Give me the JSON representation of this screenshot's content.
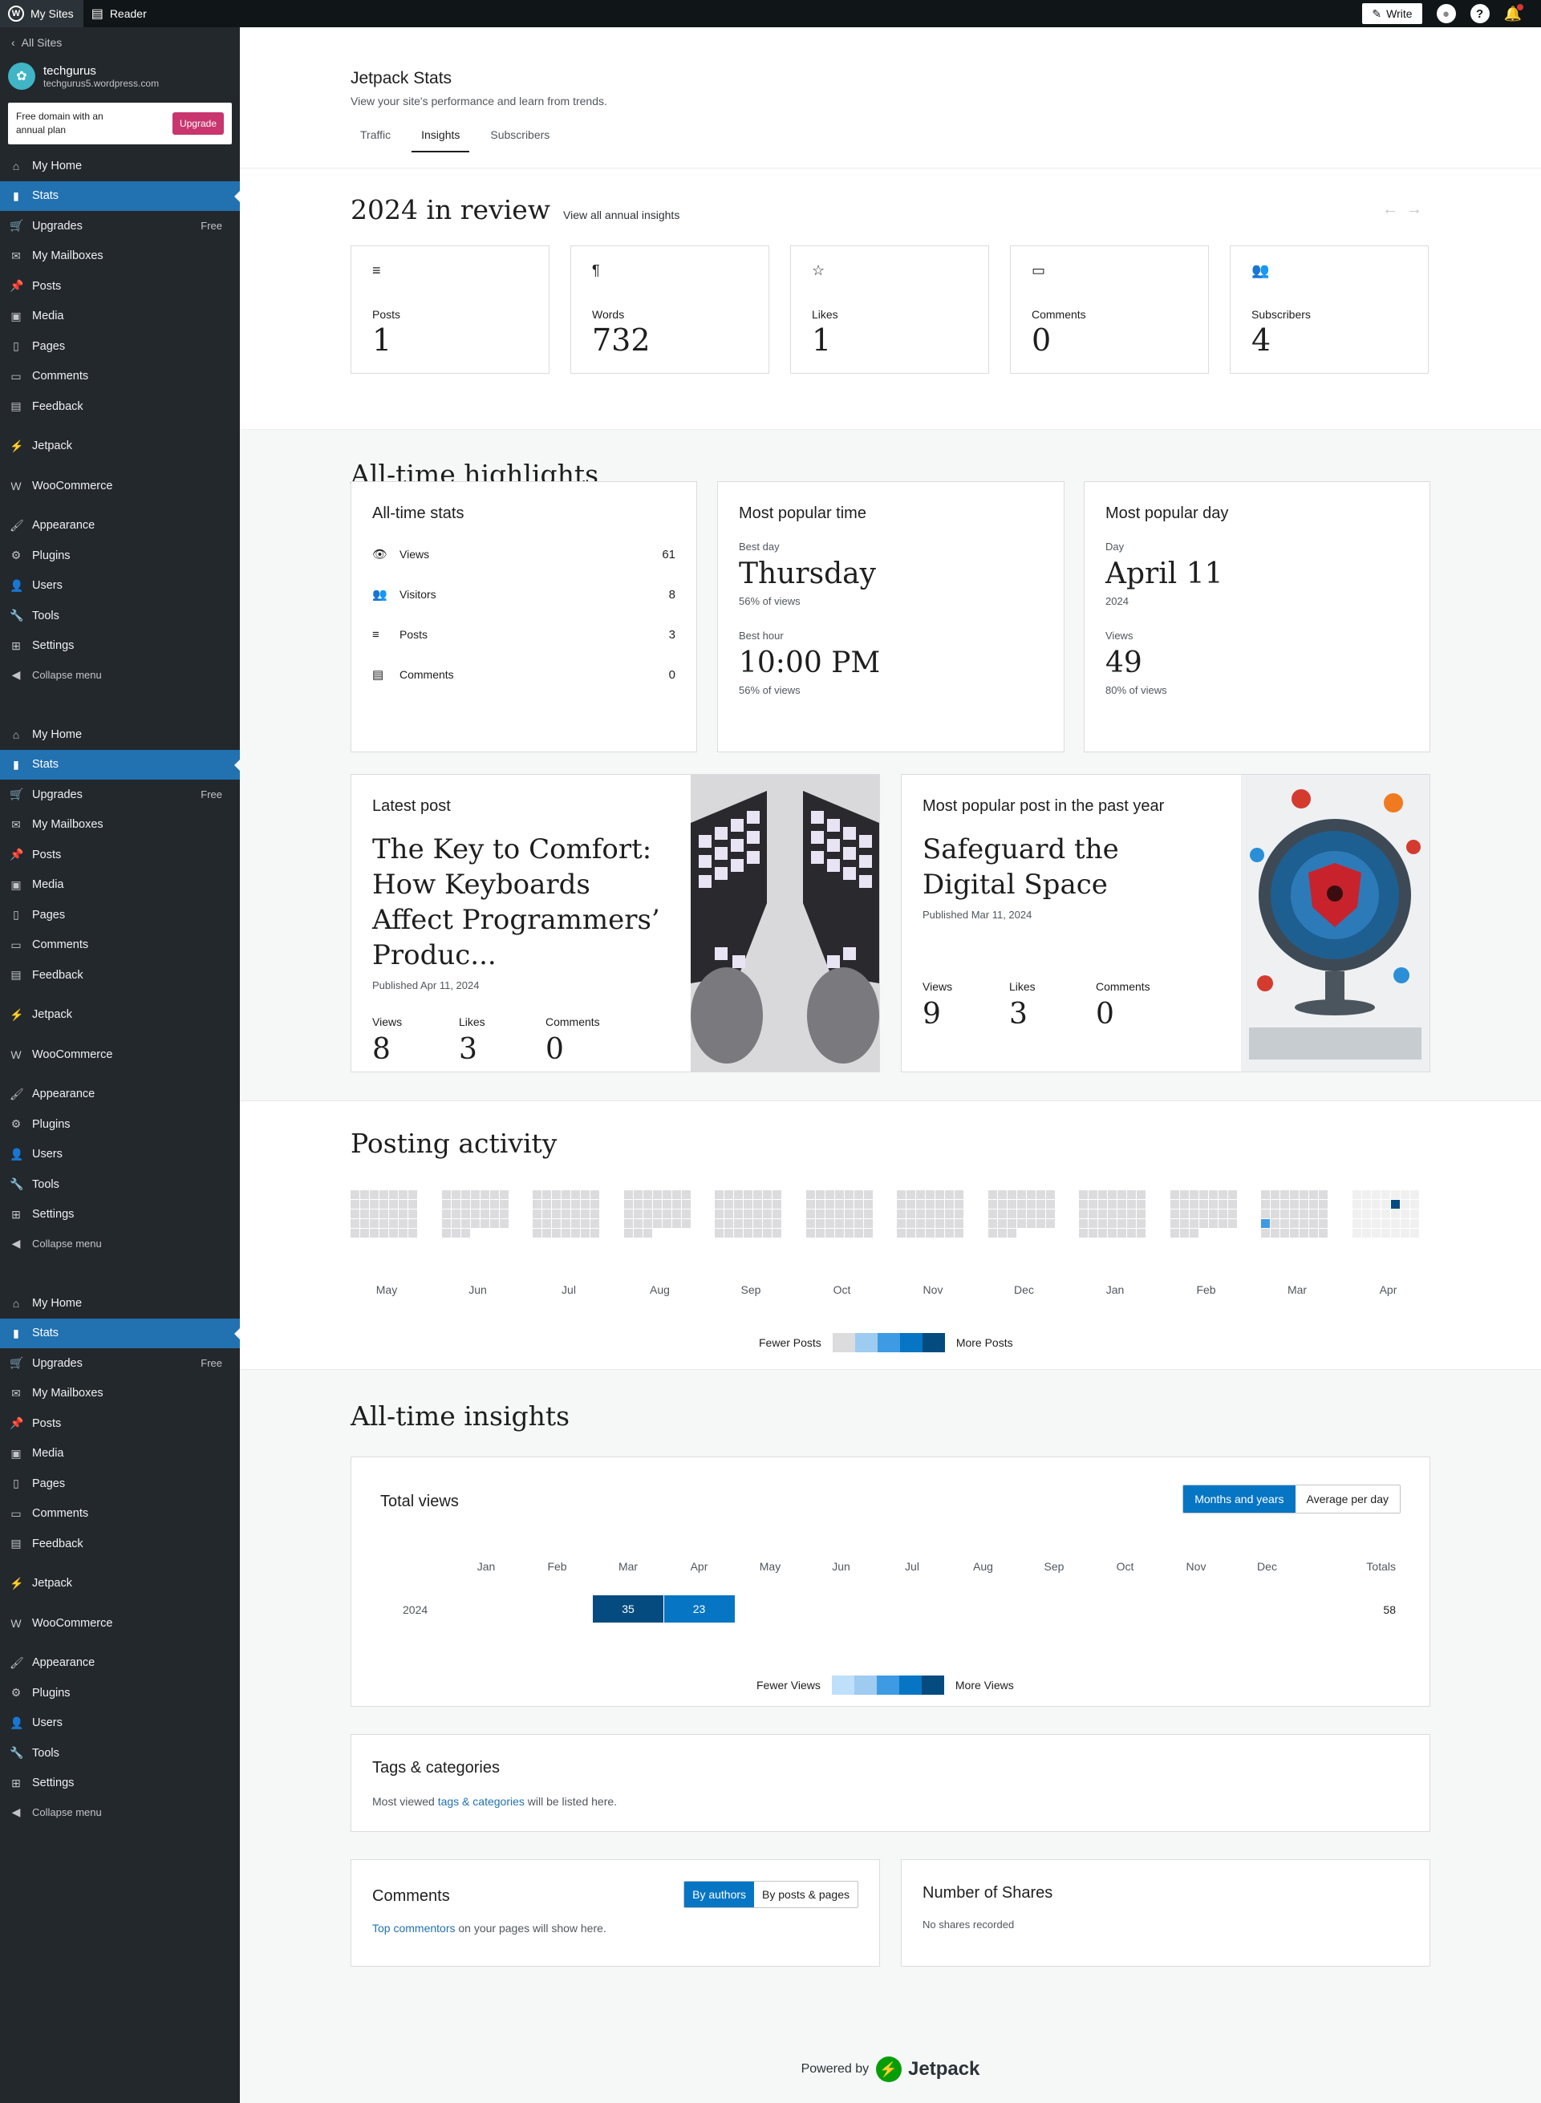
{
  "topbar": {
    "my_sites": "My Sites",
    "reader": "Reader",
    "write": "Write"
  },
  "sidebar": {
    "all_sites": "All Sites",
    "site_name": "techgurus",
    "site_url": "techgurus5.wordpress.com",
    "promo_text": "Free domain with an annual plan",
    "upgrade": "Upgrade",
    "menu_blocks": [
      {
        "items": [
          {
            "label": "My Home",
            "icon": "home-icon"
          },
          {
            "label": "Stats",
            "icon": "stats-icon",
            "active": true
          },
          {
            "label": "Upgrades",
            "icon": "upgrades-icon",
            "badge": "Free"
          },
          {
            "label": "My Mailboxes",
            "icon": "mail-icon"
          },
          {
            "label": "Posts",
            "icon": "pin-icon"
          },
          {
            "label": "Media",
            "icon": "media-icon"
          },
          {
            "label": "Pages",
            "icon": "pages-icon"
          },
          {
            "label": "Comments",
            "icon": "comment-icon"
          },
          {
            "label": "Feedback",
            "icon": "feedback-icon"
          },
          {
            "label": "Jetpack",
            "icon": "jetpack-icon"
          },
          {
            "label": "WooCommerce",
            "icon": "woo-icon"
          },
          {
            "label": "Appearance",
            "icon": "brush-icon"
          },
          {
            "label": "Plugins",
            "icon": "plugin-icon"
          },
          {
            "label": "Users",
            "icon": "users-icon"
          },
          {
            "label": "Tools",
            "icon": "tools-icon"
          },
          {
            "label": "Settings",
            "icon": "settings-icon"
          },
          {
            "label": "Collapse menu",
            "icon": "collapse-icon"
          }
        ]
      }
    ],
    "fragment_label_1": "My Home",
    "fragment_label_2": "Pages"
  },
  "header": {
    "title": "Jetpack Stats",
    "subtitle": "View your site's performance and learn from trends.",
    "tabs": [
      "Traffic",
      "Insights",
      "Subscribers"
    ]
  },
  "review": {
    "title": "2024 in review",
    "link": "View all annual insights",
    "cards": [
      {
        "label": "Posts",
        "value": "1",
        "icon": "posts-icon",
        "glyph": "≡"
      },
      {
        "label": "Words",
        "value": "732",
        "icon": "paragraph-icon",
        "glyph": "¶"
      },
      {
        "label": "Likes",
        "value": "1",
        "icon": "star-icon",
        "glyph": "☆"
      },
      {
        "label": "Comments",
        "value": "0",
        "icon": "comment-icon",
        "glyph": "▭"
      },
      {
        "label": "Subscribers",
        "value": "4",
        "icon": "people-icon",
        "glyph": "👥"
      }
    ]
  },
  "highlights": {
    "title": "All-time highlights",
    "alltime": {
      "title": "All-time stats",
      "rows": [
        {
          "label": "Views",
          "value": "61",
          "glyph": "👁"
        },
        {
          "label": "Visitors",
          "value": "8",
          "glyph": "👥"
        },
        {
          "label": "Posts",
          "value": "3",
          "glyph": "≡"
        },
        {
          "label": "Comments",
          "value": "0",
          "glyph": "▤"
        }
      ]
    },
    "popular_time": {
      "title": "Most popular time",
      "best_day_label": "Best day",
      "best_day": "Thursday",
      "best_day_pct": "56% of views",
      "best_hour_label": "Best hour",
      "best_hour": "10:00 PM",
      "best_hour_pct": "56% of views"
    },
    "popular_day": {
      "title": "Most popular day",
      "day_label": "Day",
      "day": "April 11",
      "year": "2024",
      "views_label": "Views",
      "views": "49",
      "views_pct": "80% of views"
    },
    "latest_post": {
      "title": "Latest post",
      "post": "The Key to Comfort: How Keyboards Affect Programmers’ Produc...",
      "published": "Published Apr 11, 2024",
      "views": "8",
      "likes": "3",
      "comments": "0"
    },
    "popular_post": {
      "title": "Most popular post in the past year",
      "post": "Safeguard the Digital Space",
      "published": "Published Mar 11, 2024",
      "views": "9",
      "likes": "3",
      "comments": "0"
    },
    "labels": {
      "views": "Views",
      "likes": "Likes",
      "comments": "Comments"
    }
  },
  "posting": {
    "title": "Posting activity",
    "months": [
      "May",
      "Jun",
      "Jul",
      "Aug",
      "Sep",
      "Oct",
      "Nov",
      "Dec",
      "Jan",
      "Feb",
      "Mar",
      "Apr"
    ],
    "legend_fewer": "Fewer Posts",
    "legend_more": "More Posts",
    "legend_colors": [
      "#dcdcde",
      "#9ecbf0",
      "#3e9ae3",
      "#0675c4",
      "#044b7f"
    ]
  },
  "insights": {
    "title": "All-time insights",
    "total_views": "Total views",
    "toggle": [
      "Months and years",
      "Average per day"
    ],
    "months": [
      "Jan",
      "Feb",
      "Mar",
      "Apr",
      "May",
      "Jun",
      "Jul",
      "Aug",
      "Sep",
      "Oct",
      "Nov",
      "Dec"
    ],
    "totals_label": "Totals",
    "year": "2024",
    "values": {
      "Mar": "35",
      "Apr": "23"
    },
    "total": "58",
    "legend_fewer": "Fewer Views",
    "legend_more": "More Views",
    "legend_colors": [
      "#bfe0fb",
      "#9ecbf0",
      "#3e9ae3",
      "#0675c4",
      "#044b7f"
    ]
  },
  "tags": {
    "title": "Tags & categories",
    "pre": "Most viewed ",
    "link": "tags & categories",
    "post": " will be listed here."
  },
  "comments": {
    "title": "Comments",
    "toggle": [
      "By authors",
      "By posts & pages"
    ],
    "link": "Top commentors",
    "post": " on your pages will show here."
  },
  "shares": {
    "title": "Number of Shares",
    "text": "No shares recorded"
  },
  "footer": {
    "powered": "Powered by",
    "brand": "Jetpack"
  }
}
